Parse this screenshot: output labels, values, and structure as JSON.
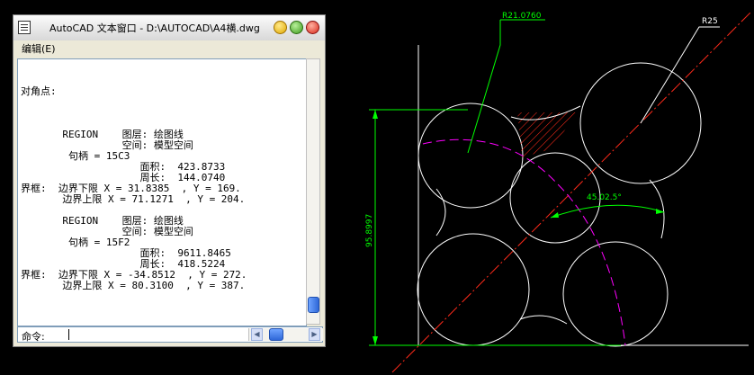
{
  "window": {
    "title": "AutoCAD 文本窗口 - D:\\AUTOCAD\\A4横.dwg",
    "menu_edit": "编辑(E)",
    "command_label": "命令:",
    "command_value": ""
  },
  "text_lines": [
    "对角点:",
    "",
    "",
    "",
    "       REGION    图层: 绘图线",
    "                 空间: 模型空间",
    "        句柄 = 15C3",
    "                    面积:  423.8733",
    "                    周长:  144.0740",
    "界框:  边界下限 X = 31.8385  , Y = 169.",
    "       边界上限 X = 71.1271  , Y = 204.",
    "",
    "       REGION    图层: 绘图线",
    "                 空间: 模型空间",
    "        句柄 = 15F2",
    "                    面积:  9611.8465",
    "                    周长:  418.5224",
    "界框:  边界下限 X = -34.8512  , Y = 272.",
    "       边界上限 X = 80.3100  , Y = 387."
  ],
  "drawing": {
    "dim_r21": "R21.0760",
    "dim_r25": "R25",
    "dim_angle": "45.02.5°",
    "dim_height": "95.8997"
  },
  "colors": {
    "background": "#000000",
    "geometry": "#ffffff",
    "dimension": "#00ff00",
    "centerline": "#ff2a1a",
    "arc": "#ff00ff",
    "hatch": "#ff2a1a"
  }
}
